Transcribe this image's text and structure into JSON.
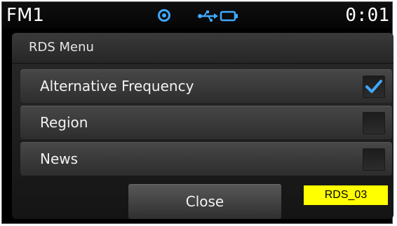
{
  "status": {
    "source": "FM1",
    "clock": "0:01",
    "icons": [
      "disc-icon",
      "usb-icon",
      "battery-icon"
    ],
    "icon_color": "#3fa8ff"
  },
  "dialog": {
    "title": "RDS Menu",
    "options": [
      {
        "label": "Alternative Frequency",
        "checked": true
      },
      {
        "label": "Region",
        "checked": false
      },
      {
        "label": "News",
        "checked": false
      }
    ],
    "close_label": "Close"
  },
  "tag": {
    "text": "RDS_03",
    "color": "#ffff00"
  }
}
